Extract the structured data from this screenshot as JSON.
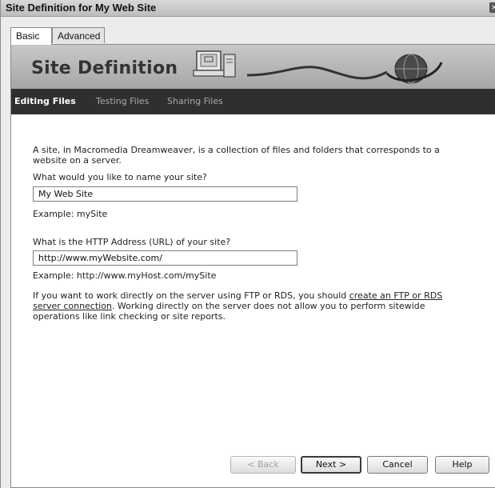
{
  "window": {
    "title": "Site Definition for My Web Site",
    "close_glyph": "×"
  },
  "tabs": [
    {
      "label": "Basic",
      "active": true
    },
    {
      "label": "Advanced",
      "active": false
    }
  ],
  "banner": {
    "title": "Site Definition",
    "art_icons": [
      "computer-icon",
      "globe-icon"
    ]
  },
  "nav": {
    "items": [
      {
        "label": "Editing Files",
        "active": true
      },
      {
        "label": "Testing Files",
        "active": false
      },
      {
        "label": "Sharing Files",
        "active": false
      }
    ]
  },
  "content": {
    "intro": "A site, in Macromedia Dreamweaver, is a collection of files and folders that corresponds to a website on a server.",
    "name_question": "What would you like to name your site?",
    "name_value": "My Web Site",
    "name_example": "Example: mySite",
    "url_question": "What is the HTTP Address (URL) of your site?",
    "url_value": "http://www.myWebsite.com/",
    "url_example": "Example: http://www.myHost.com/mySite",
    "ftp_text_before": "If you want to work directly on the server using FTP or RDS, you should ",
    "ftp_link": "create an FTP or RDS server connection",
    "ftp_text_after": ".  Working directly on the server does not allow you to perform sitewide operations like link checking or site reports."
  },
  "buttons": {
    "back": "< Back",
    "next": "Next >",
    "cancel": "Cancel",
    "help": "Help"
  },
  "colors": {
    "navbar_bg": "#2f2f2f",
    "banner_bg": "#b4b4b4"
  }
}
